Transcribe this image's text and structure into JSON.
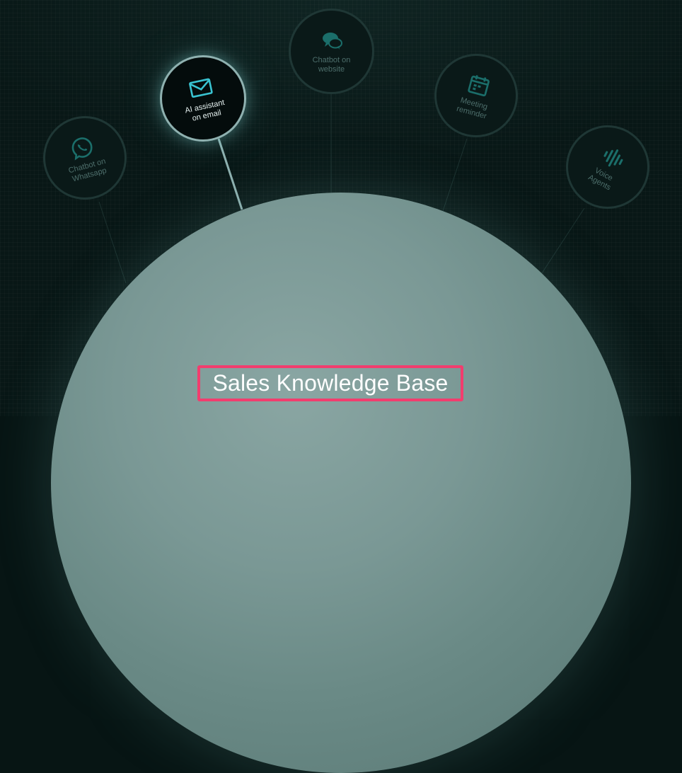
{
  "colors": {
    "background": "#081716",
    "node_border": "#1f3735",
    "node_border_active": "#8fb1b0",
    "icon": "#1b6e6a",
    "icon_active": "#39c3d1",
    "highlight": "#f23d6e",
    "planet": "#7a9895"
  },
  "nodes": [
    {
      "label": "Chatbot on\nWhatsapp",
      "icon": "whatsapp-icon",
      "active": false
    },
    {
      "label": "AI assistant\non email",
      "icon": "envelope-icon",
      "active": true
    },
    {
      "label": "Chatbot on\nwebsite",
      "icon": "chat-bubbles-icon",
      "active": false
    },
    {
      "label": "Meeting\nreminder",
      "icon": "calendar-icon",
      "active": false
    },
    {
      "label": "Voice\nAgents",
      "icon": "sound-wave-icon",
      "active": false
    }
  ],
  "knowledge_base": {
    "title": "Sales Knowledge Base"
  }
}
